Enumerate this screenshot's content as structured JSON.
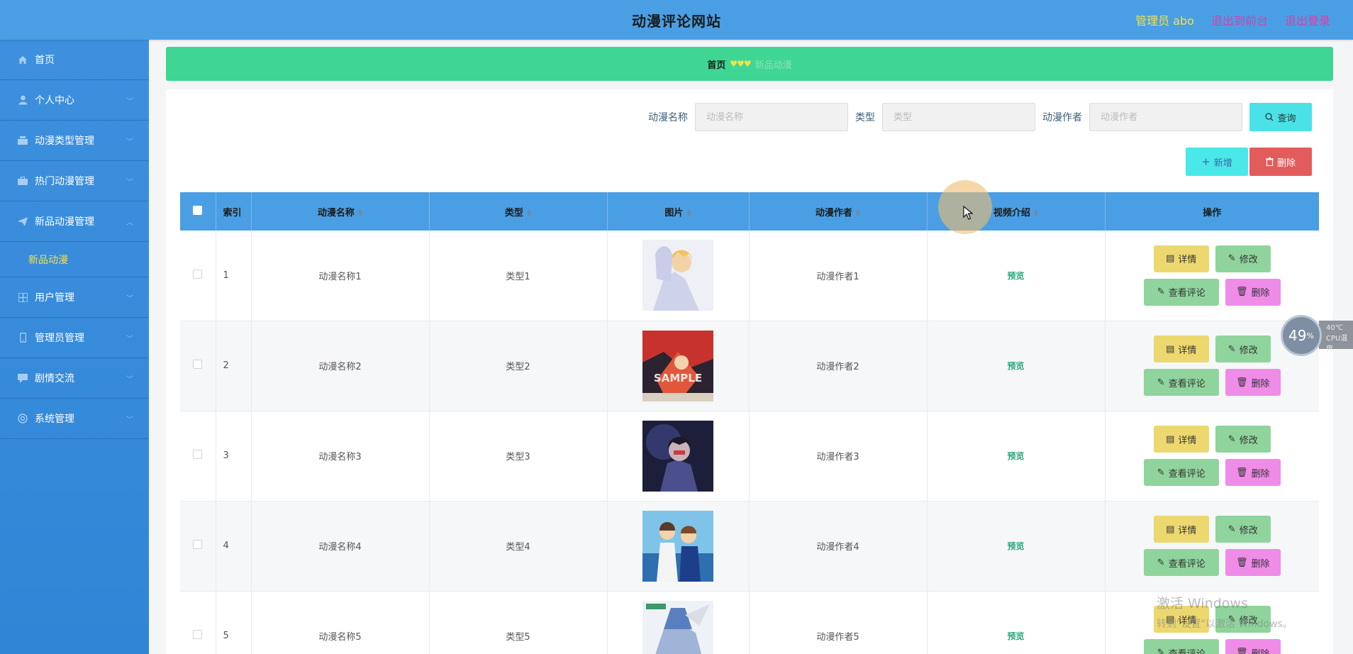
{
  "header": {
    "title": "动漫评论网站",
    "admin": "管理员 abo",
    "back_to_front": "退出到前台",
    "logout": "退出登录"
  },
  "sidebar": {
    "items": [
      {
        "label": "首页",
        "icon": "home-icon"
      },
      {
        "label": "个人中心",
        "icon": "user-icon"
      },
      {
        "label": "动漫类型管理",
        "icon": "category-icon"
      },
      {
        "label": "热门动漫管理",
        "icon": "briefcase-icon"
      },
      {
        "label": "新品动漫管理",
        "icon": "paper-plane-icon",
        "expanded": true
      },
      {
        "label": "新品动漫",
        "submenu": true,
        "active": true
      },
      {
        "label": "用户管理",
        "icon": "grid-icon"
      },
      {
        "label": "管理员管理",
        "icon": "phone-icon"
      },
      {
        "label": "剧情交流",
        "icon": "chat-icon"
      },
      {
        "label": "系统管理",
        "icon": "settings-icon"
      }
    ]
  },
  "breadcrumb": {
    "home": "首页",
    "separator": "♥♥♥",
    "current": "新品动漫"
  },
  "search": {
    "name_label": "动漫名称",
    "name_placeholder": "动漫名称",
    "type_label": "类型",
    "type_placeholder": "类型",
    "author_label": "动漫作者",
    "author_placeholder": "动漫作者",
    "query_button": "查询"
  },
  "actions": {
    "add_button": "新增",
    "delete_button": "删除"
  },
  "table": {
    "headers": {
      "index": "索引",
      "name": "动漫名称",
      "type": "类型",
      "image": "图片",
      "author": "动漫作者",
      "video": "视频介绍",
      "ops": "操作"
    },
    "rows": [
      {
        "index": "1",
        "name": "动漫名称1",
        "type": "类型1",
        "author": "动漫作者1",
        "video": "预览"
      },
      {
        "index": "2",
        "name": "动漫名称2",
        "type": "类型2",
        "author": "动漫作者2",
        "video": "预览"
      },
      {
        "index": "3",
        "name": "动漫名称3",
        "type": "类型3",
        "author": "动漫作者3",
        "video": "预览"
      },
      {
        "index": "4",
        "name": "动漫名称4",
        "type": "类型4",
        "author": "动漫作者4",
        "video": "预览"
      },
      {
        "index": "5",
        "name": "动漫名称5",
        "type": "类型5",
        "author": "动漫作者5",
        "video": "预览"
      }
    ],
    "ops": {
      "detail": "详情",
      "edit": "修改",
      "comments": "查看评论",
      "remove": "删除"
    }
  },
  "overlay": {
    "cpu_percent": "49",
    "cpu_percent_sign": "%",
    "cpu_temp": "40℃",
    "cpu_label": "CPU温度",
    "activate_line1": "激活 Windows",
    "activate_line2": "转到\"设置\"以激活 Windows。"
  },
  "colors": {
    "header": "#4a9fe4",
    "sidebar": "#3a8bdb",
    "breadcrumb": "#3fd693",
    "accent_yellow": "#f3e24a",
    "link_pink": "#d93ea8"
  }
}
